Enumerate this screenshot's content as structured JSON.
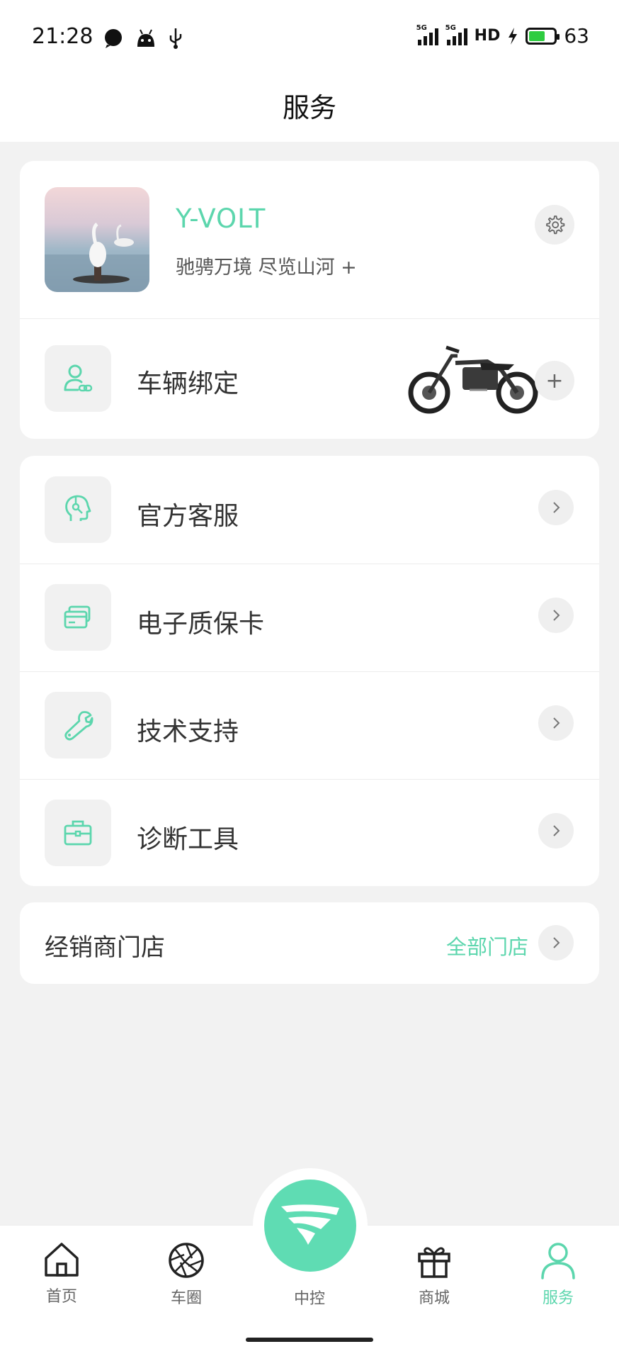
{
  "status_bar": {
    "time": "21:28",
    "net_label": "5G",
    "hd_label": "HD",
    "battery": "63",
    "battery_level": 0.63
  },
  "header": {
    "title": "服务"
  },
  "profile": {
    "name": "Y-VOLT",
    "slogan": "驰骋万境 尽览山河 +",
    "settings_icon": "gear-icon"
  },
  "vehicle": {
    "label": "车辆绑定",
    "icon": "user-link-icon",
    "add_symbol": "+"
  },
  "services": [
    {
      "label": "官方客服",
      "icon": "support-head-icon"
    },
    {
      "label": "电子质保卡",
      "icon": "cards-icon"
    },
    {
      "label": "技术支持",
      "icon": "wrench-icon"
    },
    {
      "label": "诊断工具",
      "icon": "toolbox-icon"
    }
  ],
  "dealer": {
    "label": "经销商门店",
    "link": "全部门店"
  },
  "tabs": [
    {
      "label": "首页",
      "icon": "home-icon",
      "active": false
    },
    {
      "label": "车圈",
      "icon": "aperture-icon",
      "active": false
    },
    {
      "label": "中控",
      "icon": "logo-icon",
      "active": false
    },
    {
      "label": "商城",
      "icon": "gift-icon",
      "active": false
    },
    {
      "label": "服务",
      "icon": "person-icon",
      "active": true
    }
  ],
  "colors": {
    "accent": "#5cd6ad",
    "center_button": "#5fdcb3",
    "background": "#f2f2f2",
    "battery_fill": "#2ecc40"
  }
}
